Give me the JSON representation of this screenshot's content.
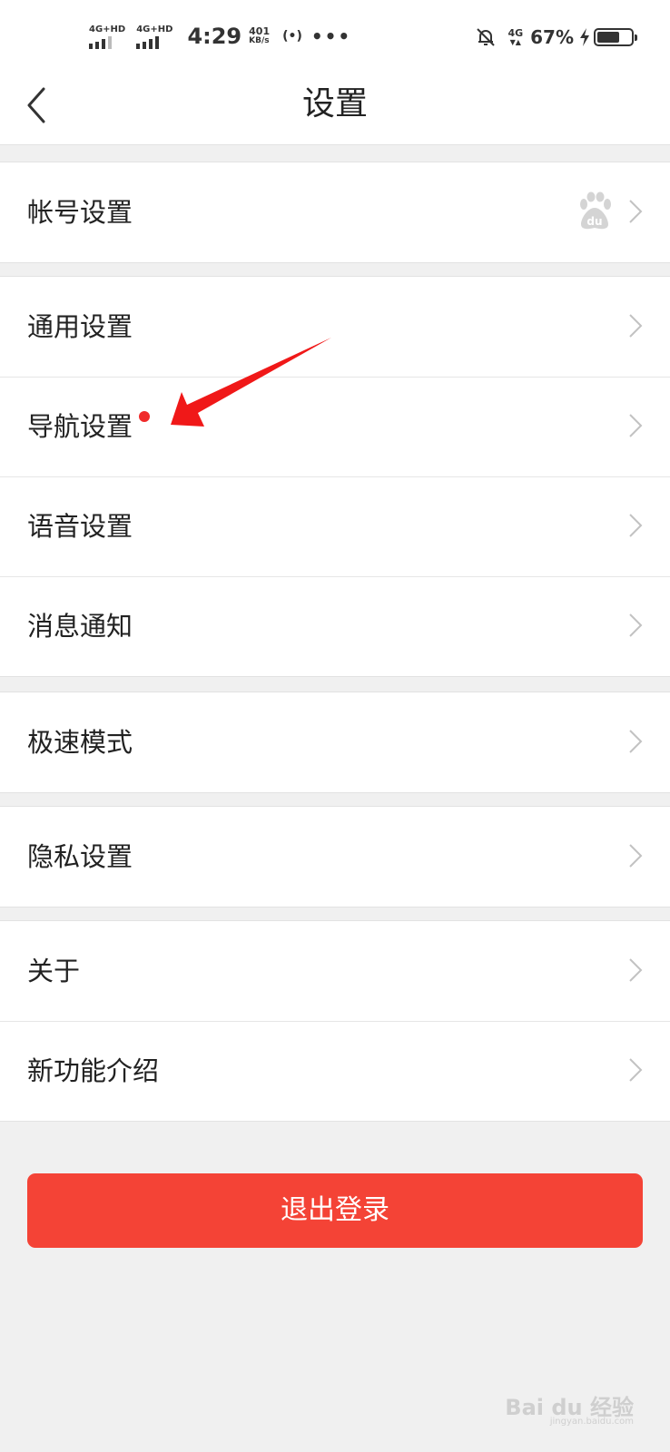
{
  "status_bar": {
    "sim1_label": "4G+HD",
    "sim2_label": "4G+HD",
    "time": "4:29",
    "net_speed_value": "401",
    "net_speed_unit": "KB/s",
    "hotspot": "(•)",
    "more": "•••",
    "network": "4G",
    "battery_percent": "67%",
    "battery_level": 0.67
  },
  "header": {
    "title": "设置"
  },
  "groups": [
    {
      "items": [
        {
          "label": "帐号设置",
          "right_icon": "baidu-paw-icon"
        }
      ]
    },
    {
      "items": [
        {
          "label": "通用设置"
        },
        {
          "label": "导航设置",
          "badge": "red-dot"
        },
        {
          "label": "语音设置"
        },
        {
          "label": "消息通知"
        }
      ]
    },
    {
      "items": [
        {
          "label": "极速模式"
        }
      ]
    },
    {
      "items": [
        {
          "label": "隐私设置"
        }
      ]
    },
    {
      "items": [
        {
          "label": "关于"
        },
        {
          "label": "新功能介绍"
        }
      ]
    }
  ],
  "logout_button": {
    "label": "退出登录"
  },
  "watermark": {
    "brand": "Bai du 经验",
    "url": "jingyan.baidu.com"
  },
  "colors": {
    "accent": "#f44336",
    "badge": "#f02a2a",
    "background": "#f0f0f0",
    "annotation_arrow": "#f01818"
  }
}
